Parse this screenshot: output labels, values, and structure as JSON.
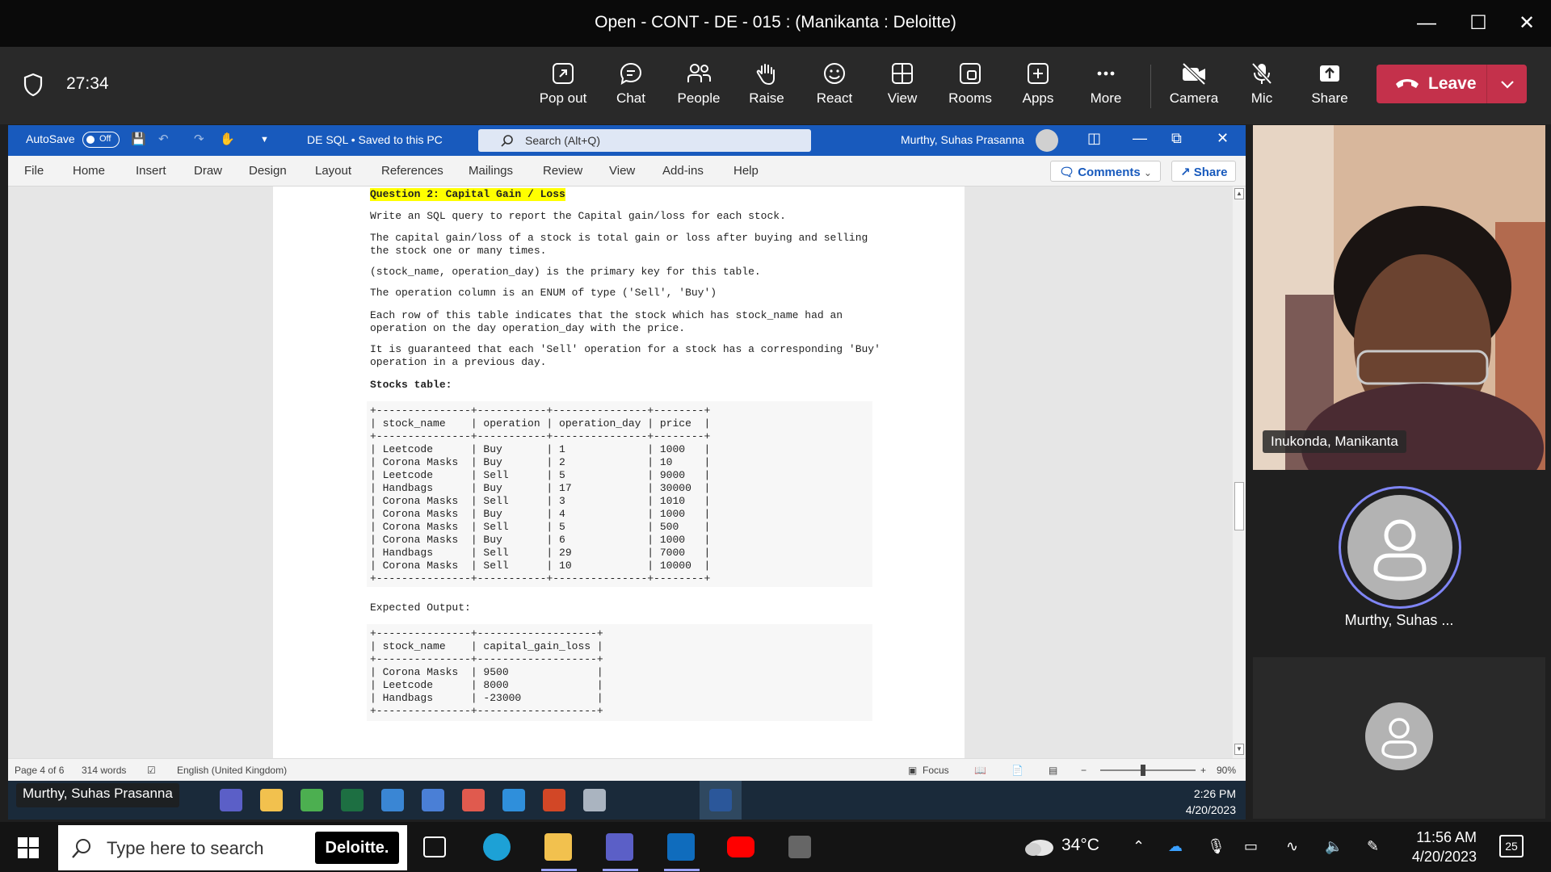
{
  "window": {
    "title": "Open - CONT - DE - 015 : (Manikanta : Deloitte)"
  },
  "meeting": {
    "timer": "27:34",
    "buttons": [
      {
        "label": "Pop out",
        "icon": "pop-out-icon"
      },
      {
        "label": "Chat",
        "icon": "chat-icon"
      },
      {
        "label": "People",
        "icon": "people-icon"
      },
      {
        "label": "Raise",
        "icon": "raise-hand-icon"
      },
      {
        "label": "React",
        "icon": "react-icon"
      },
      {
        "label": "View",
        "icon": "view-icon"
      },
      {
        "label": "Rooms",
        "icon": "rooms-icon"
      },
      {
        "label": "Apps",
        "icon": "apps-icon"
      },
      {
        "label": "More",
        "icon": "more-icon"
      },
      {
        "label": "Camera",
        "icon": "camera-off-icon"
      },
      {
        "label": "Mic",
        "icon": "mic-off-icon"
      },
      {
        "label": "Share",
        "icon": "share-icon"
      }
    ],
    "leave_label": "Leave",
    "leave_color": "#c4314b"
  },
  "word": {
    "autosave_label": "AutoSave",
    "autosave_state": "Off",
    "doc_name": "DE SQL • Saved to this PC",
    "search_placeholder": "Search (Alt+Q)",
    "user_name": "Murthy, Suhas Prasanna",
    "tabs": [
      "File",
      "Home",
      "Insert",
      "Draw",
      "Design",
      "Layout",
      "References",
      "Mailings",
      "Review",
      "View",
      "Add-ins",
      "Help"
    ],
    "comments_label": "Comments",
    "share_label": "Share",
    "accent": "#185abd",
    "doc": {
      "heading": "Question 2: Capital Gain / Loss",
      "p1": "Write an SQL query to report the Capital gain/loss for each stock.",
      "p2a": "The capital gain/loss of a stock is total gain or loss after buying and selling",
      "p2b": "the stock one or many times.",
      "p3": "(stock_name, operation_day) is the primary key for this table.",
      "p4": "The operation column is an ENUM of type ('Sell', 'Buy')",
      "p5a": "Each row of this table indicates that the stock which has stock_name had an",
      "p5b": "operation on the day operation_day with the price.",
      "p6a": "It is guaranteed that each 'Sell' operation for a stock has a corresponding 'Buy'",
      "p6b": "operation in a previous day.",
      "stocks_label": "Stocks table:",
      "stocks_table": [
        "+---------------+-----------+---------------+--------+",
        "| stock_name    | operation | operation_day | price  |",
        "+---------------+-----------+---------------+--------+",
        "| Leetcode      | Buy       | 1             | 1000   |",
        "| Corona Masks  | Buy       | 2             | 10     |",
        "| Leetcode      | Sell      | 5             | 9000   |",
        "| Handbags      | Buy       | 17            | 30000  |",
        "| Corona Masks  | Sell      | 3             | 1010   |",
        "| Corona Masks  | Buy       | 4             | 1000   |",
        "| Corona Masks  | Sell      | 5             | 500    |",
        "| Corona Masks  | Buy       | 6             | 1000   |",
        "| Handbags      | Sell      | 29            | 7000   |",
        "| Corona Masks  | Sell      | 10            | 10000  |",
        "+---------------+-----------+---------------+--------+"
      ],
      "expected_label": "Expected Output:",
      "output_table": [
        "+---------------+-------------------+",
        "| stock_name    | capital_gain_loss |",
        "+---------------+-------------------+",
        "| Corona Masks  | 9500              |",
        "| Leetcode      | 8000              |",
        "| Handbags      | -23000            |",
        "+---------------+-------------------+"
      ]
    },
    "status": {
      "page": "Page 4 of 6",
      "words": "314 words",
      "language": "English (United Kingdom)",
      "focus": "Focus",
      "zoom": "90%"
    }
  },
  "remote_taskbar": {
    "presenter": "Murthy, Suhas Prasanna",
    "time": "2:26 PM",
    "date": "4/20/2023"
  },
  "participants": [
    {
      "name": "Inukonda, Manikanta"
    },
    {
      "name": "Murthy, Suhas ..."
    }
  ],
  "taskbar": {
    "search_placeholder": "Type here to search",
    "brand": "Deloitte.",
    "temperature": "34°C",
    "time": "11:56 AM",
    "date": "4/20/2023",
    "notifications": "25"
  }
}
